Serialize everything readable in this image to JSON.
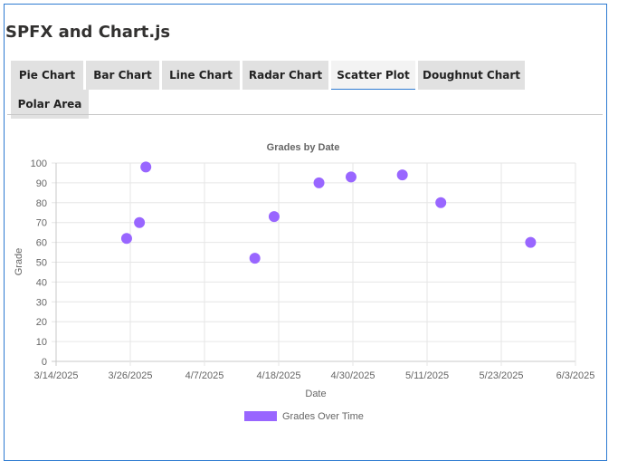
{
  "app": {
    "title": "SPFX and Chart.js"
  },
  "tabs": [
    {
      "label": "Pie Chart",
      "active": false
    },
    {
      "label": "Bar Chart",
      "active": false
    },
    {
      "label": "Line Chart",
      "active": false
    },
    {
      "label": "Radar Chart",
      "active": false
    },
    {
      "label": "Scatter Plot",
      "active": true
    },
    {
      "label": "Doughnut Chart",
      "active": false
    },
    {
      "label": "Polar Area",
      "active": false
    }
  ],
  "chart_data": {
    "type": "scatter",
    "title": "Grades by Date",
    "xlabel": "Date",
    "ylabel": "Grade",
    "x_ticks": [
      "3/14/2025",
      "3/26/2025",
      "4/7/2025",
      "4/18/2025",
      "4/30/2025",
      "5/11/2025",
      "5/23/2025",
      "6/3/2025"
    ],
    "xlim": [
      "2025-03-14",
      "2025-06-03"
    ],
    "ylim": [
      0,
      100
    ],
    "y_ticks": [
      0,
      10,
      20,
      30,
      40,
      50,
      60,
      70,
      80,
      90,
      100
    ],
    "grid": true,
    "legend_position": "bottom",
    "series": [
      {
        "name": "Grades Over Time",
        "color": "#9966ff",
        "points": [
          {
            "x": "2025-03-25",
            "y": 62
          },
          {
            "x": "2025-03-27",
            "y": 70
          },
          {
            "x": "2025-03-28",
            "y": 98
          },
          {
            "x": "2025-04-14",
            "y": 52
          },
          {
            "x": "2025-04-17",
            "y": 73
          },
          {
            "x": "2025-04-24",
            "y": 90
          },
          {
            "x": "2025-04-29",
            "y": 93
          },
          {
            "x": "2025-05-07",
            "y": 94
          },
          {
            "x": "2025-05-13",
            "y": 80
          },
          {
            "x": "2025-05-27",
            "y": 60
          }
        ]
      }
    ]
  }
}
